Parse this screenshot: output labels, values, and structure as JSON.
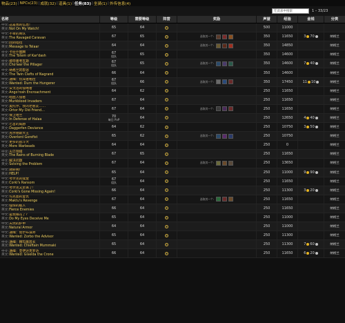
{
  "tabs": [
    {
      "label": "物品(23)",
      "active": false
    },
    {
      "label": "NPCs(23)",
      "active": false
    },
    {
      "label": "成就(32)",
      "active": false
    },
    {
      "label": "道具(1)",
      "active": false
    },
    {
      "label": "任务(83)",
      "active": true
    },
    {
      "label": "坐骑(1)",
      "active": false
    },
    {
      "label": "外传信息(4)",
      "active": false
    }
  ],
  "search": {
    "placeholder": "在此表中搜索"
  },
  "pager": {
    "text": "1 – 33/23"
  },
  "columns": {
    "name": "名称",
    "level": "等级",
    "req": "需要等级",
    "type": "阵营",
    "reward": "奖励",
    "rep": "声望",
    "xp": "经验",
    "gold": "金钱",
    "share": "分类"
  },
  "labels": {
    "zh": "中文:",
    "en": "英文:",
    "choose": "选取其一个:"
  },
  "rows": [
    {
      "zh": "这是我的信息!",
      "en": "Not On My Watch!",
      "level": "65",
      "sub": "",
      "req": "64",
      "reward_icons": [],
      "rep": "500",
      "xp": "11000",
      "gold": "",
      "silver": "",
      "share": ""
    },
    {
      "zh": "不幸的商队",
      "en": "The Ravaged Caravan",
      "level": "67",
      "sub": "",
      "req": "65",
      "reward_icons": [
        "#5a3a2a",
        "#7a2a2a",
        "#8a5020"
      ],
      "rep": "350",
      "xp": "11650",
      "gold": "3",
      "silver": "70",
      "share": "纳格兰"
    },
    {
      "zh": "回到塔拉",
      "en": "Message to Telaar",
      "level": "64",
      "sub": "",
      "req": "64",
      "reward_icons": [
        "#6a5a30",
        "#5a2a1a",
        "#a03020"
      ],
      "rep": "350",
      "xp": "14850",
      "gold": "",
      "silver": "",
      "share": "纳格兰"
    },
    {
      "zh": "卡拉什图腾",
      "en": "The Totem of Kar'dash",
      "level": "67",
      "sub": "组队",
      "req": "65",
      "reward_icons": [],
      "rep": "350",
      "xp": "14600",
      "gold": "",
      "silver": "",
      "share": "纳格兰"
    },
    {
      "zh": "掠夺者考瓦斯",
      "en": "Cho'war the Pillager",
      "level": "67",
      "sub": "组队",
      "req": "65",
      "reward_icons": [
        "#2a4a6a",
        "#4a3a6a",
        "#2a5a4a"
      ],
      "rep": "350",
      "xp": "14600",
      "gold": "7",
      "silver": "40",
      "share": "纳格兰"
    },
    {
      "zh": "纳格兰的裂谷",
      "en": "The Twin Clefts of Nagrand",
      "level": "66",
      "sub": "",
      "req": "64",
      "reward_icons": [],
      "rep": "350",
      "xp": "14600",
      "gold": "",
      "silver": "",
      "share": "纳格兰"
    },
    {
      "zh": "通缉：饥渴者格拉",
      "en": "Wanted: Durn the Hungerer",
      "level": "67",
      "sub": "组队",
      "req": "66",
      "reward_icons": [
        "#6a6a6a",
        "#2a4a7a",
        "#6a2a2a"
      ],
      "rep": "350",
      "xp": "17450",
      "gold": "11",
      "silver": "10",
      "share": "纳格兰"
    },
    {
      "zh": "安戈洛的侵略者",
      "en": "Ango'rosh Encroachment",
      "level": "64",
      "sub": "",
      "req": "62",
      "reward_icons": [],
      "rep": "250",
      "xp": "11650",
      "gold": "",
      "silver": "",
      "share": "纳格兰"
    },
    {
      "zh": "暗血入侵者",
      "en": "Murkblood Invaders",
      "level": "67",
      "sub": "",
      "req": "64",
      "reward_icons": [],
      "rep": "250",
      "xp": "11650",
      "gold": "",
      "silver": "",
      "share": "纳格兰"
    },
    {
      "zh": "奥托尔，我的老朋友……",
      "en": "Ortor My Old Friend…",
      "level": "67",
      "sub": "",
      "req": "64",
      "reward_icons": [
        "#3a3a3a",
        "#4a2a5a",
        "#6a2a2a"
      ],
      "rep": "250",
      "xp": "11650",
      "gold": "",
      "silver": "",
      "share": "纳格兰"
    },
    {
      "zh": "保卫哈兰",
      "en": "In Defense of Halaa",
      "level": "70",
      "sub": "每日 PvP",
      "req": "64",
      "reward_icons": [],
      "rep": "250",
      "xp": "12650",
      "gold": "4",
      "silver": "40",
      "share": "纳格兰"
    },
    {
      "zh": "匕首的威胁",
      "en": "Daggerfen Deviance",
      "level": "64",
      "sub": "",
      "req": "62",
      "reward_icons": [],
      "rep": "250",
      "xp": "10750",
      "gold": "3",
      "silver": "50",
      "share": "纳格兰"
    },
    {
      "zh": "克尔德斯大王",
      "en": "Overlord Gorefist",
      "level": "65",
      "sub": "",
      "req": "62",
      "reward_icons": [
        "#2a4a6a",
        "#5a2a6a",
        "#2a3a6a"
      ],
      "rep": "250",
      "xp": "10750",
      "gold": "",
      "silver": "",
      "share": "纳格兰"
    },
    {
      "zh": "更多的战斗犬",
      "en": "More Warbeads",
      "level": "64",
      "sub": "",
      "req": "64",
      "reward_icons": [],
      "rep": "250",
      "xp": "0",
      "gold": "",
      "silver": "",
      "share": "纳格兰"
    },
    {
      "zh": "火刃领域",
      "en": "The Rains of Burning Blade",
      "level": "67",
      "sub": "",
      "req": "65",
      "reward_icons": [],
      "rep": "250",
      "xp": "11650",
      "gold": "",
      "silver": "",
      "share": "纳格兰"
    },
    {
      "zh": "解决问题",
      "en": "Solving the Problem",
      "level": "67",
      "sub": "",
      "req": "64",
      "reward_icons": [
        "#6a6a3a",
        "#6a4a2a",
        "#5a4a3a"
      ],
      "rep": "250",
      "xp": "13650",
      "gold": "",
      "silver": "",
      "share": "纳格兰"
    },
    {
      "zh": "救命啊!",
      "en": "HELP!",
      "level": "65",
      "sub": "",
      "req": "64",
      "reward_icons": [],
      "rep": "250",
      "xp": "11000",
      "gold": "9",
      "silver": "90",
      "share": "纳格兰"
    },
    {
      "zh": "考尔克的赎金",
      "en": "Corki's Ransom",
      "level": "67",
      "sub": "组队",
      "req": "64",
      "reward_icons": [],
      "rep": "250",
      "xp": "11650",
      "gold": "",
      "silver": "",
      "share": "纳格兰"
    },
    {
      "zh": "考尔克又走丢了!",
      "en": "Corki's Gone Missing Again!",
      "level": "66",
      "sub": "",
      "req": "64",
      "reward_icons": [],
      "rep": "250",
      "xp": "11300",
      "gold": "3",
      "silver": "20",
      "share": "纳格兰"
    },
    {
      "zh": "玛克图的复仇",
      "en": "Maktu's Revenge",
      "level": "67",
      "sub": "",
      "req": "64",
      "reward_icons": [
        "#2a6a3a",
        "#6a2a2a",
        "#6a4a2a"
      ],
      "rep": "250",
      "xp": "11650",
      "gold": "",
      "silver": "",
      "share": "纳格兰"
    },
    {
      "zh": "强悍的敌人",
      "en": "Fierce Enemies",
      "level": "66",
      "sub": "",
      "req": "64",
      "reward_icons": [],
      "rep": "250",
      "xp": "11650",
      "gold": "",
      "silver": "",
      "share": "纳格兰"
    },
    {
      "zh": "是我眼花了?",
      "en": "Do My Eyes Deceive Me",
      "level": "65",
      "sub": "",
      "req": "64",
      "reward_icons": [],
      "rep": "250",
      "xp": "11000",
      "gold": "",
      "silver": "",
      "share": "纳格兰"
    },
    {
      "zh": "天然的护甲",
      "en": "Natural Armor",
      "level": "64",
      "sub": "",
      "req": "64",
      "reward_icons": [],
      "rep": "250",
      "xp": "11000",
      "gold": "",
      "silver": "",
      "share": "纳格兰"
    },
    {
      "zh": "通缉：佐尔布谋师",
      "en": "Wanted: Zorbo the Advisor",
      "level": "65",
      "sub": "",
      "req": "64",
      "reward_icons": [],
      "rep": "250",
      "xp": "11300",
      "gold": "",
      "silver": "",
      "share": "纳格兰"
    },
    {
      "zh": "通缉：穆玛基酋长",
      "en": "Wanted: Chieftain Mummaki",
      "level": "65",
      "sub": "",
      "req": "64",
      "reward_icons": [],
      "rep": "250",
      "xp": "11300",
      "gold": "7",
      "silver": "60",
      "share": "纳格兰"
    },
    {
      "zh": "通缉：亚伊达克罗达",
      "en": "Wanted: Giselda the Crone",
      "level": "66",
      "sub": "",
      "req": "64",
      "reward_icons": [],
      "rep": "250",
      "xp": "11650",
      "gold": "6",
      "silver": "20",
      "share": "纳格兰"
    }
  ]
}
